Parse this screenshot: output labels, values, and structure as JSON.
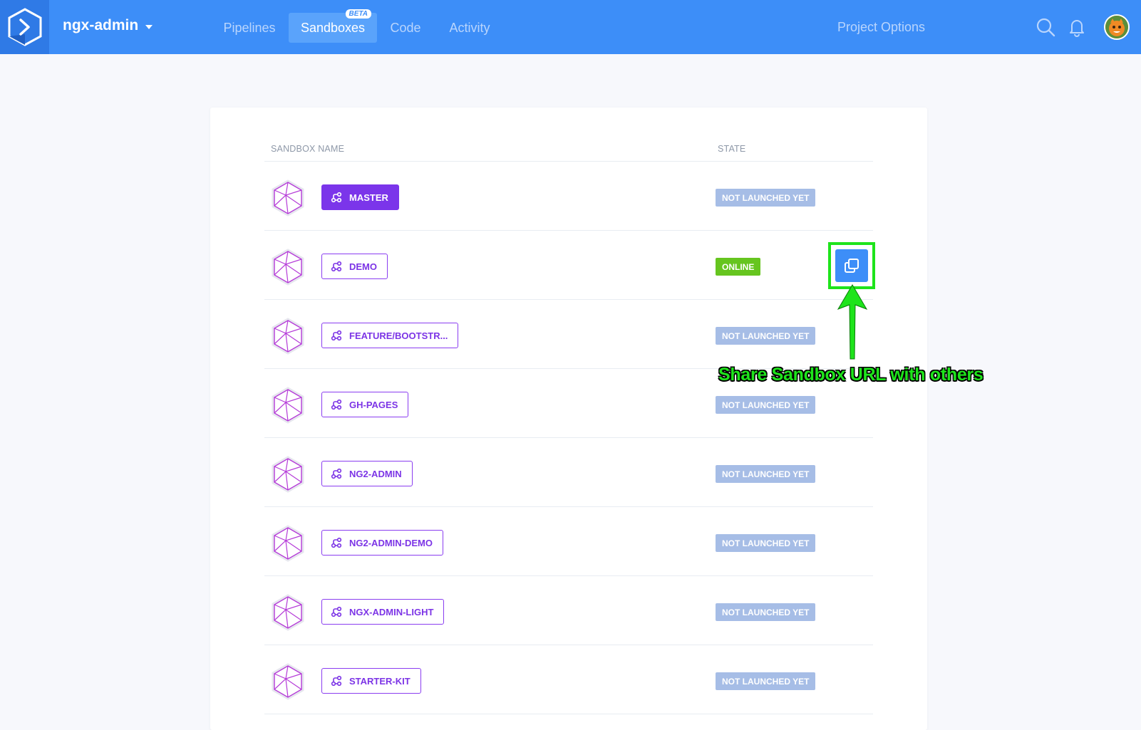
{
  "header": {
    "project_name": "ngx-admin",
    "tabs": [
      {
        "label": "Pipelines",
        "active": false
      },
      {
        "label": "Sandboxes",
        "active": true,
        "badge": "BETA"
      },
      {
        "label": "Code",
        "active": false
      },
      {
        "label": "Activity",
        "active": false
      }
    ],
    "project_options": "Project Options",
    "icons": [
      "search-icon",
      "bell-icon"
    ],
    "accent_color": "#3d8ef8"
  },
  "table": {
    "columns": {
      "name": "SANDBOX NAME",
      "state": "STATE"
    },
    "rows": [
      {
        "name": "MASTER",
        "state": "NOT LAUNCHED YET",
        "selected": true
      },
      {
        "name": "DEMO",
        "state": "ONLINE",
        "selected": false
      },
      {
        "name": "FEATURE/BOOTSTR...",
        "state": "NOT LAUNCHED YET",
        "selected": false
      },
      {
        "name": "GH-PAGES",
        "state": "NOT LAUNCHED YET",
        "selected": false
      },
      {
        "name": "NG2-ADMIN",
        "state": "NOT LAUNCHED YET",
        "selected": false
      },
      {
        "name": "NG2-ADMIN-DEMO",
        "state": "NOT LAUNCHED YET",
        "selected": false
      },
      {
        "name": "NGX-ADMIN-LIGHT",
        "state": "NOT LAUNCHED YET",
        "selected": false
      },
      {
        "name": "STARTER-KIT",
        "state": "NOT LAUNCHED YET",
        "selected": false
      }
    ],
    "state_colors": {
      "offline": "#a6bde6",
      "online": "#66c51f"
    }
  },
  "annotation": {
    "text": "Share Sandbox URL with others",
    "color": "#1ee41b"
  }
}
